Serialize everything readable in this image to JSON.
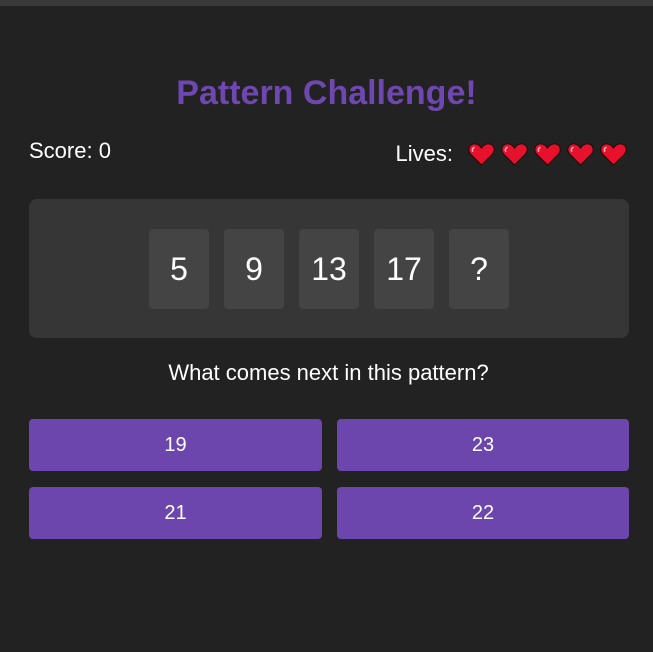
{
  "game": {
    "title": "Pattern Challenge!",
    "score_text": "Score: 0",
    "lives_label": "Lives:",
    "lives_count": 5,
    "sequence": [
      "5",
      "9",
      "13",
      "17",
      "?"
    ],
    "question": "What comes next in this pattern?",
    "options": [
      "19",
      "23",
      "21",
      "22"
    ]
  },
  "colors": {
    "title": "#6f47b0",
    "button": "#6c46ad",
    "heart": "#e8112d",
    "background": "#222222",
    "panel": "#363636",
    "tile": "#444444"
  },
  "icons": {
    "life": "heart-icon"
  }
}
